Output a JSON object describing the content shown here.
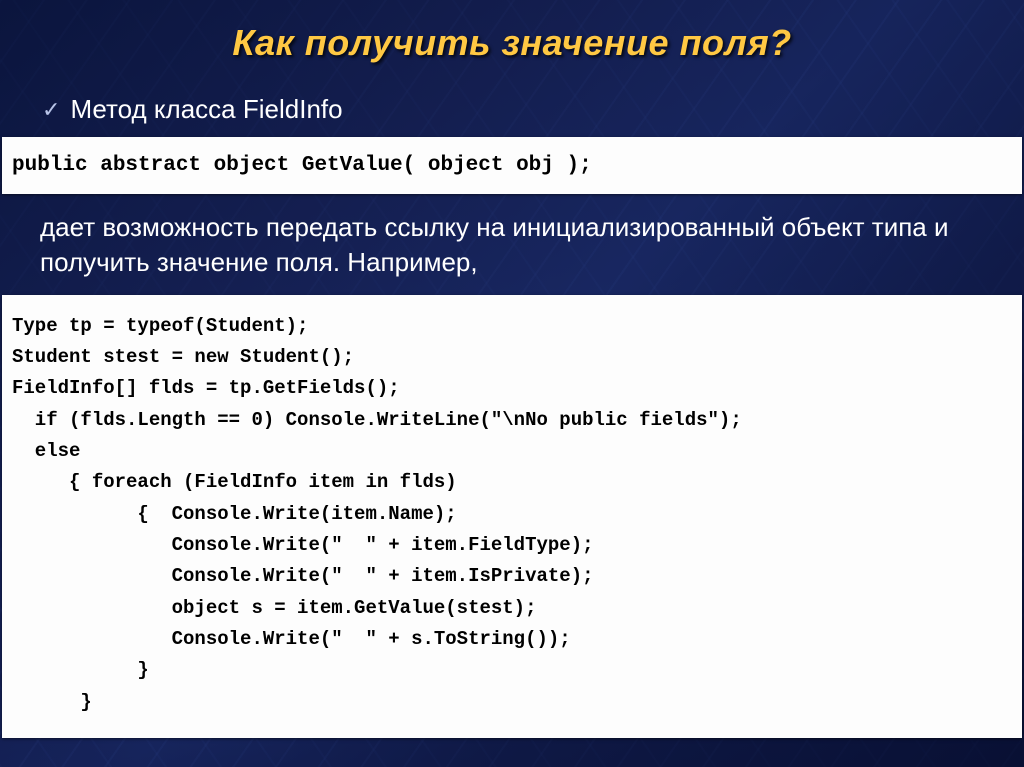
{
  "title": "Как получить значение поля?",
  "bullet": "Метод класса FieldInfo",
  "signature": "public abstract object GetValue( object obj );",
  "description": "дает возможность передать ссылку на инициализированный объект типа и получить значение поля. Например,",
  "code": "Type tp = typeof(Student);\nStudent stest = new Student();\nFieldInfo[] flds = tp.GetFields();\n  if (flds.Length == 0) Console.WriteLine(\"\\nNo public fields\");\n  else\n     { foreach (FieldInfo item in flds)\n           {  Console.Write(item.Name);\n              Console.Write(\"  \" + item.FieldType);\n              Console.Write(\"  \" + item.IsPrivate);\n              object s = item.GetValue(stest);\n              Console.Write(\"  \" + s.ToString());\n           }\n      }"
}
